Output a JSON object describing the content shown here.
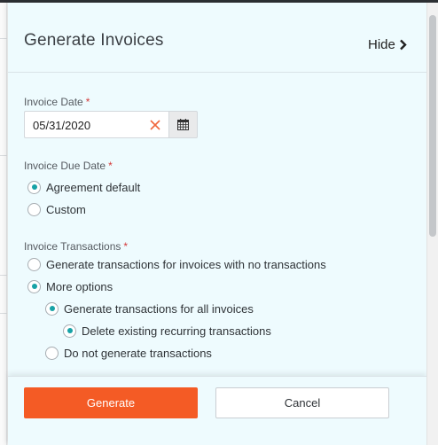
{
  "panel": {
    "title": "Generate Invoices",
    "hide_label": "Hide"
  },
  "invoice_date": {
    "label": "Invoice Date",
    "required_marker": "*",
    "value": "05/31/2020"
  },
  "invoice_due_date": {
    "label": "Invoice Due Date",
    "required_marker": "*",
    "options": [
      {
        "label": "Agreement default",
        "selected": true
      },
      {
        "label": "Custom",
        "selected": false
      }
    ]
  },
  "invoice_transactions": {
    "label": "Invoice Transactions",
    "required_marker": "*",
    "options": [
      {
        "label": "Generate transactions for invoices with no transactions",
        "selected": false
      },
      {
        "label": "More options",
        "selected": true
      },
      {
        "label": "Generate transactions for all invoices",
        "selected": true
      },
      {
        "label": "Delete existing recurring transactions",
        "selected": true
      },
      {
        "label": "Do not generate transactions",
        "selected": false
      }
    ]
  },
  "footer": {
    "generate_label": "Generate",
    "cancel_label": "Cancel"
  },
  "colors": {
    "accent": "#17a2a6",
    "primary_button": "#f45b25",
    "required": "#d43a3a",
    "panel_bg": "#eefbfe"
  },
  "icons": {
    "hide": "chevron-right-icon",
    "clear": "close-icon",
    "calendar": "calendar-icon"
  }
}
